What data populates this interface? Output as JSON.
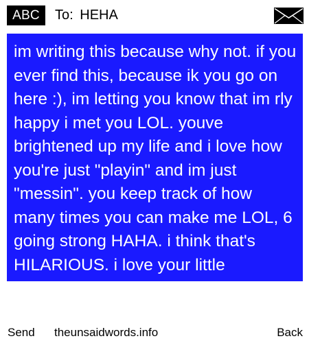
{
  "header": {
    "badge_label": "ABC",
    "to_label": "To:",
    "to_value": "HEHA",
    "envelope_icon": "envelope-icon"
  },
  "message": {
    "text": "im writing this because why not. if you ever find this, because ik you go on here :), im letting you know that im rly happy i met you LOL. youve brightened up my life and i love how you're just \"playin\" and im just \"messin\". you keep track of how many times you can make me LOL, 6 going strong HAHA. i think that's HILARIOUS. i love your little",
    "background_color": "#1a1aff",
    "text_color": "#ffffff"
  },
  "footer": {
    "send_label": "Send",
    "site_label": "theunsaidwords.info",
    "back_label": "Back"
  }
}
